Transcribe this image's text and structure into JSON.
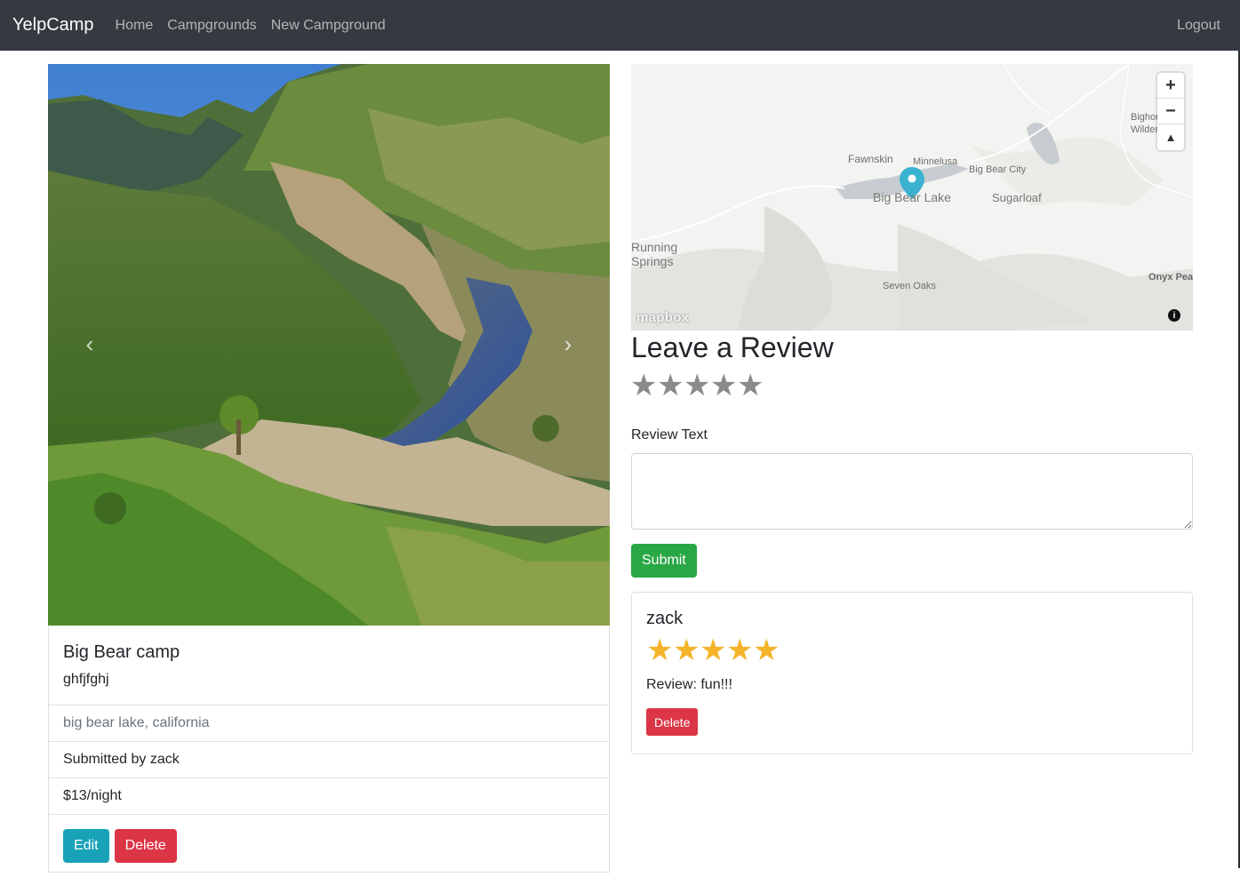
{
  "navbar": {
    "brand": "YelpCamp",
    "links": [
      "Home",
      "Campgrounds",
      "New Campground"
    ],
    "logout": "Logout"
  },
  "campground": {
    "title": "Big Bear camp",
    "description": "ghfjfghj",
    "location": "big bear lake, california",
    "submitted_by": "Submitted by zack",
    "price": "$13/night",
    "edit_label": "Edit",
    "delete_label": "Delete"
  },
  "carousel": {
    "prev": "‹",
    "next": "›"
  },
  "map": {
    "labels": {
      "fawnskin": "Fawnskin",
      "minnelusa": "Minnelusa",
      "big_bear_city": "Big Bear City",
      "big_bear_lake": "Big Bear Lake",
      "sugarloaf": "Sugarloaf",
      "running_springs": "Running\nSprings",
      "seven_oaks": "Seven Oaks",
      "onyx_peak": "Onyx Peal",
      "bighorn": "Bighorn\nWilderness"
    },
    "zoom_in": "+",
    "zoom_out": "−",
    "compass": "▲",
    "logo": "mapbox",
    "info": "i"
  },
  "review_form": {
    "heading": "Leave a Review",
    "rating_stars": [
      "★",
      "★",
      "★",
      "★",
      "★"
    ],
    "text_label": "Review Text",
    "text_value": "",
    "submit_label": "Submit"
  },
  "reviews": [
    {
      "author": "zack",
      "rating": 5,
      "stars": [
        "★",
        "★",
        "★",
        "★",
        "★"
      ],
      "body": "Review: fun!!!",
      "delete_label": "Delete"
    }
  ],
  "colors": {
    "navbar": "#343a40",
    "info": "#17a2b8",
    "danger": "#dc3545",
    "success": "#28a745",
    "star_filled": "#f5b32a",
    "star_empty": "#8a8a8a",
    "map_pin": "#3bb2d0"
  }
}
